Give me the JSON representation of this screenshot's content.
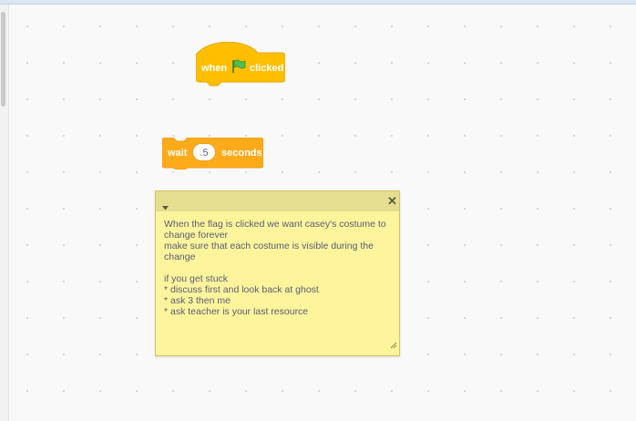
{
  "hat_block": {
    "when_label": "when",
    "icon": "green-flag-icon",
    "clicked_label": "clicked",
    "color": "#ffbf00"
  },
  "wait_block": {
    "wait_label": "wait",
    "duration_value": ".5",
    "seconds_label": "seconds",
    "color": "#ffab19"
  },
  "comment": {
    "collapse_icon": "chevron-down-icon",
    "close_icon": "close-icon",
    "text": "When the flag is clicked we want casey's costume to change forever\nmake sure that each costume is visible during the change\n\nif you get stuck\n* discuss first and look back at ghost\n* ask 3 then me\n* ask teacher is your last resource",
    "background_color": "#fef49c",
    "header_color": "#e5dd8f"
  }
}
